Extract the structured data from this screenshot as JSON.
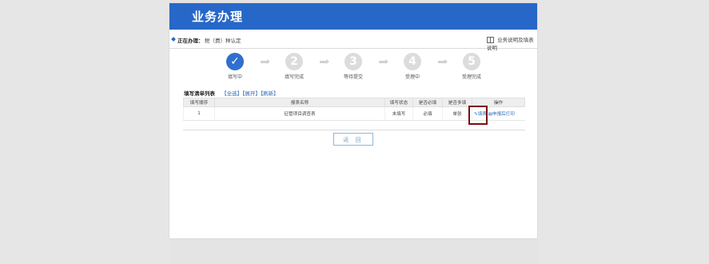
{
  "header": {
    "title": "业务办理"
  },
  "info": {
    "current_label": "正在办理：",
    "current_item": "税（费）种认定",
    "help_link": "业务说明及填表说明"
  },
  "steps": [
    {
      "number": "✓",
      "label": "填写中",
      "active": true
    },
    {
      "number": "2",
      "label": "填写完成",
      "active": false
    },
    {
      "number": "3",
      "label": "等待提交",
      "active": false
    },
    {
      "number": "4",
      "label": "受理中",
      "active": false
    },
    {
      "number": "5",
      "label": "受理完成",
      "active": false
    }
  ],
  "list": {
    "title": "填写清单列表",
    "controls": [
      "【全选】",
      "【展开】",
      "【刷新】"
    ],
    "columns": [
      "填写顺序",
      "报表名称",
      "填写状态",
      "是否必填",
      "是否多填",
      "操作"
    ],
    "rows": [
      {
        "order": "1",
        "name": "征管项目调查表",
        "status": "未填写",
        "required": "必填",
        "multi": "单张",
        "op_fill": "填表",
        "op_print": "申报后打印"
      }
    ]
  },
  "buttons": {
    "back": "返 回"
  },
  "colors": {
    "header_bg": "#2767c8",
    "highlight_border": "#7a0e0e",
    "link": "#2a6ab8"
  }
}
